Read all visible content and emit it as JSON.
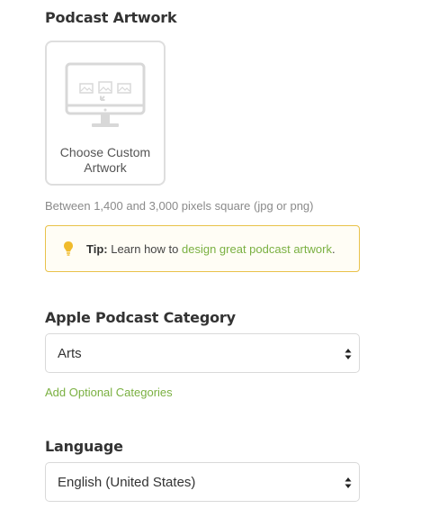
{
  "artwork": {
    "title": "Podcast Artwork",
    "button_label": "Choose Custom Artwork",
    "icon": "monitor-upload-icon",
    "hint": "Between 1,400 and 3,000 pixels square (jpg or png)"
  },
  "tip": {
    "icon": "lightbulb-icon",
    "prefix": "Tip:",
    "text": "Learn how to",
    "link_text": "design great podcast artwork",
    "suffix": ".",
    "border_color": "#e9c24a",
    "link_color": "#7ab041"
  },
  "category": {
    "title": "Apple Podcast Category",
    "selected": "Arts",
    "add_link": "Add Optional Categories"
  },
  "language": {
    "title": "Language",
    "selected": "English (United States)"
  }
}
